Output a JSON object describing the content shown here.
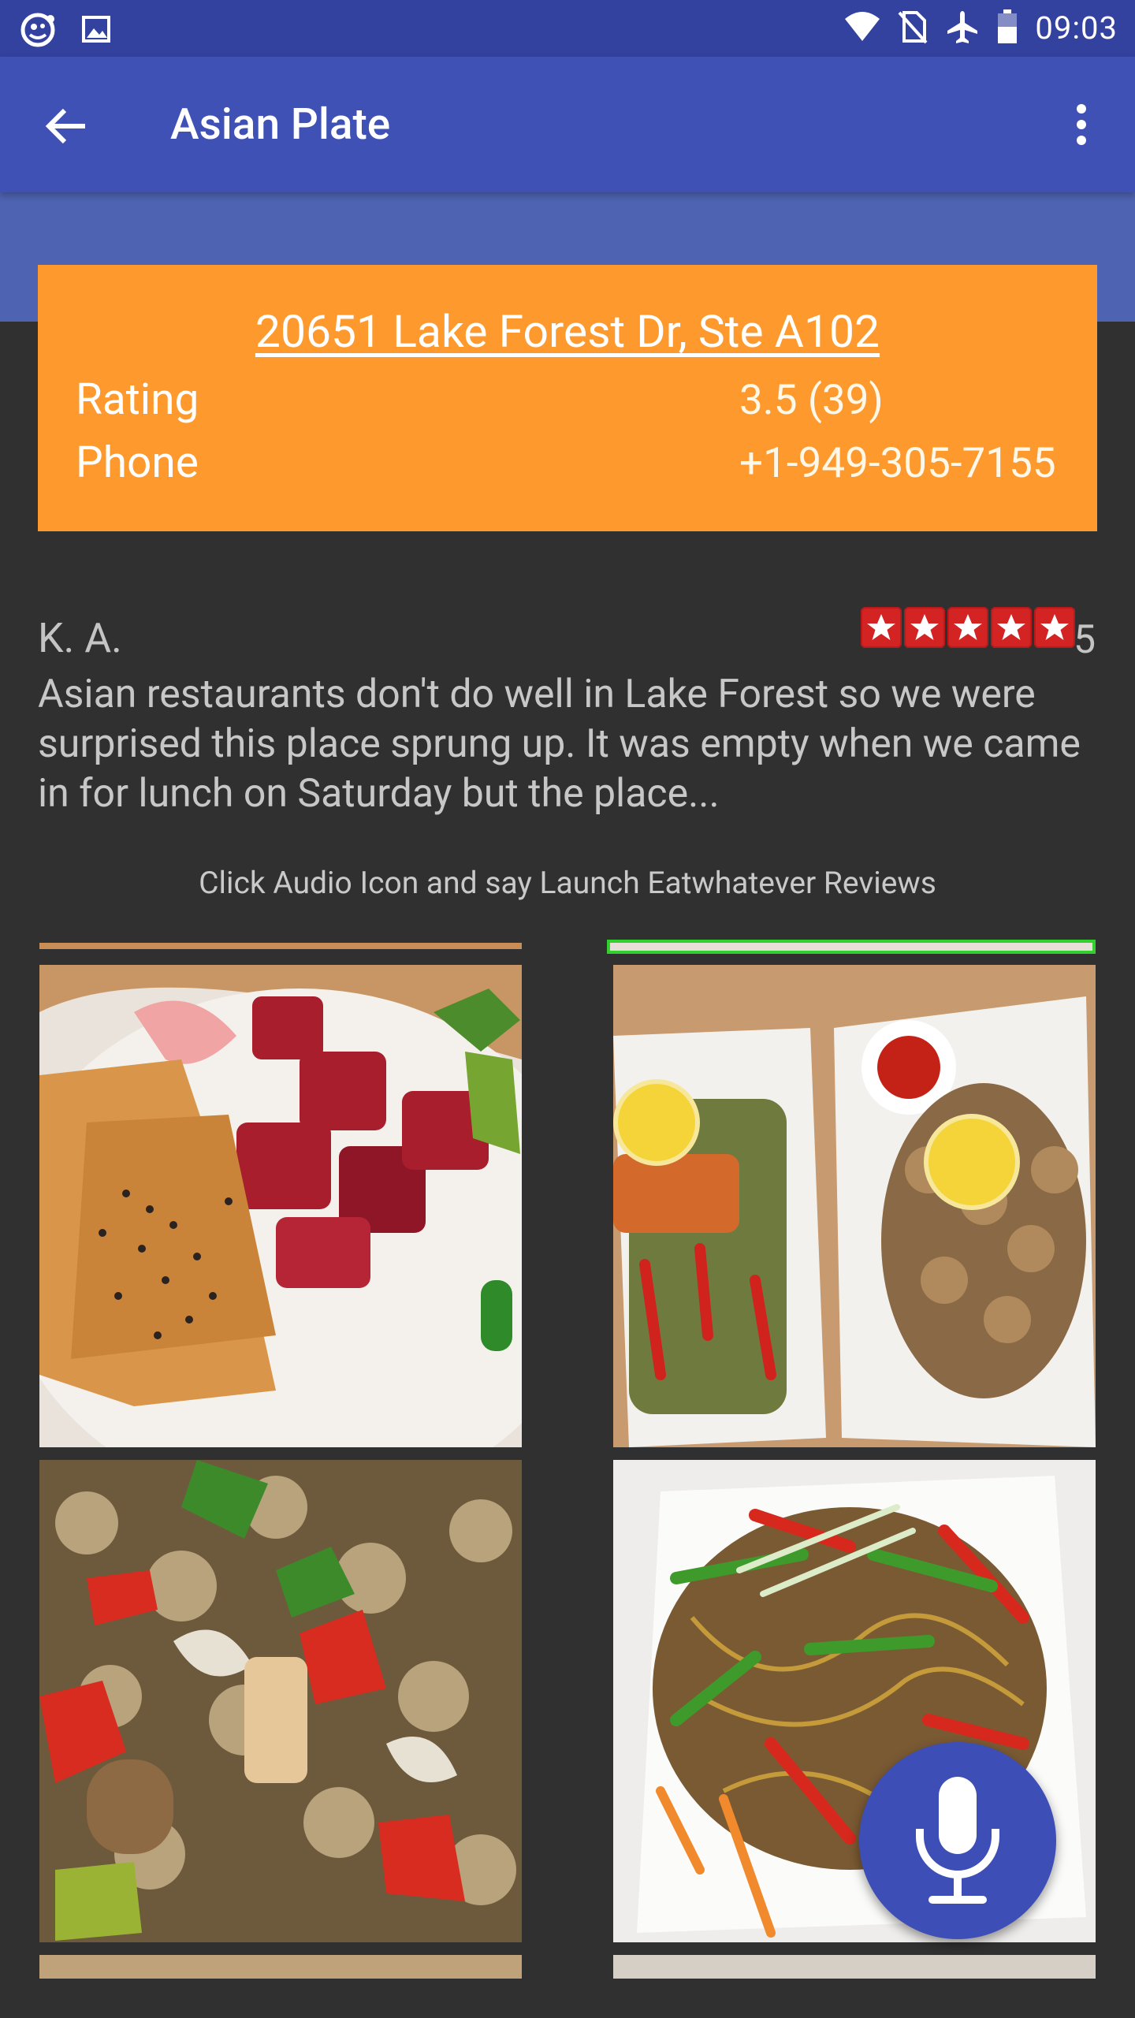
{
  "status_bar": {
    "time": "09:03",
    "left_icons": [
      "notification-app-icon",
      "image-notification-icon"
    ],
    "right_icons": [
      "wifi-icon",
      "no-sim-icon",
      "airplane-mode-icon",
      "battery-icon"
    ]
  },
  "app_bar": {
    "title": "Asian Plate",
    "back_icon": "arrow-back-icon",
    "menu_icon": "more-vert-icon"
  },
  "info_card": {
    "address": "20651 Lake Forest Dr, Ste A102",
    "rows": [
      {
        "label": "Rating",
        "value": "3.5 (39)"
      },
      {
        "label": "Phone",
        "value": "+1-949-305-7155"
      }
    ],
    "background_color": "#fe9a2d"
  },
  "review": {
    "author": "K. A.",
    "stars": 5,
    "star_count_label": "5",
    "text": "Asian restaurants don't do well in Lake Forest so we were surprised this place sprung up. It was empty when we came in for lunch on Saturday but the place..."
  },
  "hint": "Click Audio Icon and say Launch Eatwhatever Reviews",
  "photos": [
    "wonton-tuna-poke-photo",
    "salmon-and-calamari-plates-photo",
    "kung-pao-chicken-photo",
    "stir-fry-noodles-photo"
  ],
  "fab": {
    "icon": "microphone-icon"
  },
  "colors": {
    "primary": "#3f51b5",
    "primary_dark": "#33419f",
    "accent": "#fe9a2d",
    "background": "#303030"
  }
}
